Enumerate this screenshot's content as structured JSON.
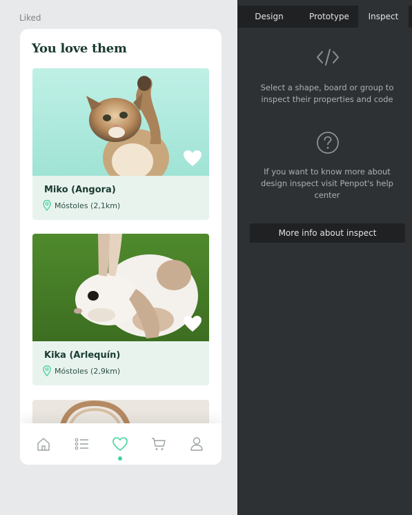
{
  "canvas": {
    "board_label": "Liked"
  },
  "phone": {
    "title": "You love them",
    "cards": [
      {
        "name": "Miko (Angora)",
        "location": "Móstoles (2,1km)",
        "liked": true
      },
      {
        "name": "Kika (Arlequín)",
        "location": "Móstoles (2,9km)",
        "liked": true
      }
    ],
    "tabbar": {
      "items": [
        "home-icon",
        "list-icon",
        "heart-icon",
        "cart-icon",
        "user-icon"
      ],
      "active": "heart-icon",
      "accent_color": "#3fd29a"
    }
  },
  "panel": {
    "tabs": [
      "Design",
      "Prototype",
      "Inspect"
    ],
    "active_tab": "Inspect",
    "code_hint": "Select a shape, board or group to inspect their properties and code",
    "help_hint": "If you want to know more about design inspect visit Penpot's help center",
    "more_info_button": "More info about inspect"
  }
}
